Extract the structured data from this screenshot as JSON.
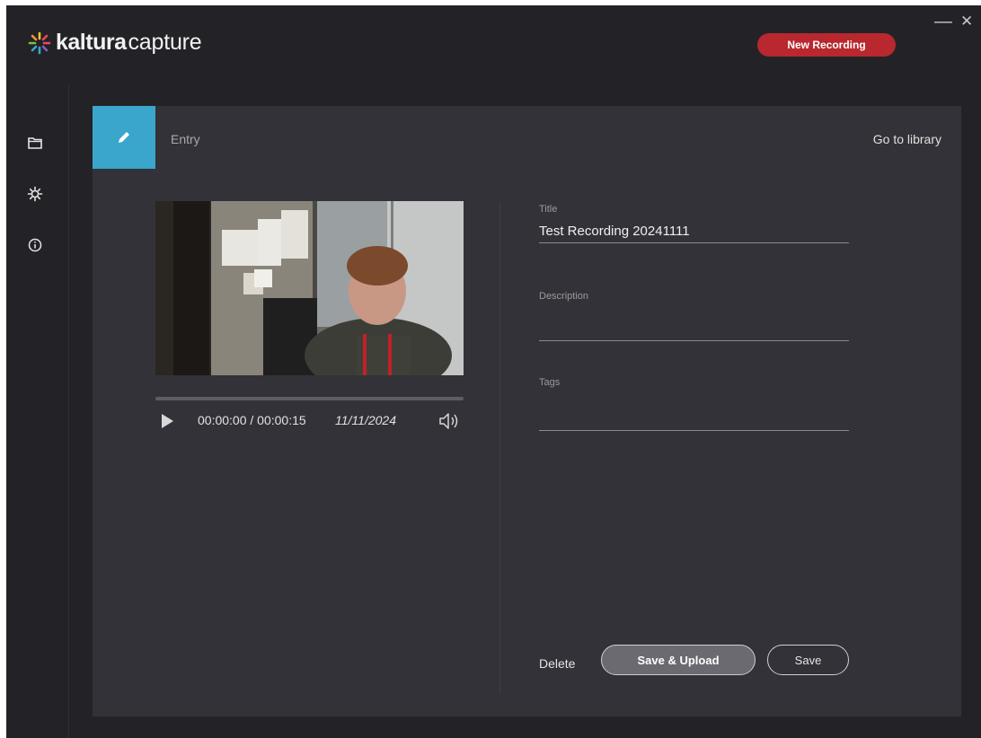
{
  "app": {
    "logo_bold": "kaltura",
    "logo_light": "capture",
    "new_recording_label": "New Recording",
    "colors": {
      "accent": "#3aa6cc",
      "record": "#b8282e",
      "background": "#232327",
      "panel": "#323238"
    }
  },
  "window_controls": {
    "minimize": "—",
    "close": "✕"
  },
  "sidebar": {
    "items": [
      {
        "icon": "folder-icon"
      },
      {
        "icon": "gear-icon"
      },
      {
        "icon": "info-icon"
      }
    ]
  },
  "entry": {
    "tab_label": "Entry",
    "go_to_library": "Go to library"
  },
  "player": {
    "time": "00:00:00 / 00:00:15",
    "date": "11/11/2024",
    "progress": 0
  },
  "form": {
    "title_label": "Title",
    "title_value": "Test Recording 20241111",
    "description_label": "Description",
    "description_value": "",
    "tags_label": "Tags",
    "tags_value": ""
  },
  "actions": {
    "delete": "Delete",
    "save_upload": "Save & Upload",
    "save": "Save"
  }
}
